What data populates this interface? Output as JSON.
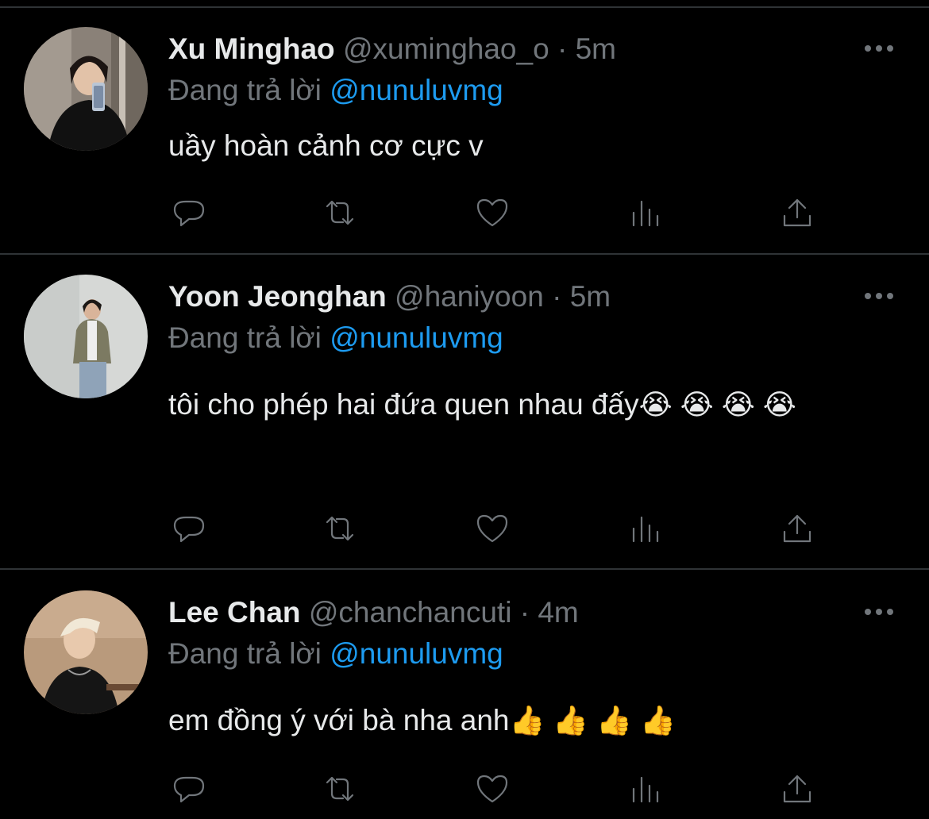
{
  "tweets": [
    {
      "name": "Xu Minghao",
      "handle": "@xuminghao_o",
      "separator": "·",
      "time": "5m",
      "reply_prefix": "Đang trả lời",
      "reply_to": "@nunuluvmg",
      "text": "uầy hoàn cảnh cơ cực v",
      "emoji": ""
    },
    {
      "name": "Yoon Jeonghan",
      "handle": "@haniyoon",
      "separator": "·",
      "time": "5m",
      "reply_prefix": "Đang trả lời",
      "reply_to": "@nunuluvmg",
      "text": "tôi cho phép hai đứa quen nhau đấy",
      "emoji": "😭 😭 😭 😭"
    },
    {
      "name": "Lee Chan",
      "handle": "@chanchancuti",
      "separator": "·",
      "time": "4m",
      "reply_prefix": "Đang trả lời",
      "reply_to": "@nunuluvmg",
      "text": "em đồng ý với bà nha anh",
      "emoji": "👍 👍 👍 👍"
    }
  ],
  "icons": {
    "reply": "reply-icon",
    "retweet": "retweet-icon",
    "like": "like-icon",
    "views": "views-icon",
    "share": "share-icon",
    "more": "more-icon"
  },
  "colors": {
    "background": "#000000",
    "text": "#e7e9ea",
    "muted": "#71767b",
    "link": "#1d9bf0",
    "divider": "#2f3336"
  }
}
